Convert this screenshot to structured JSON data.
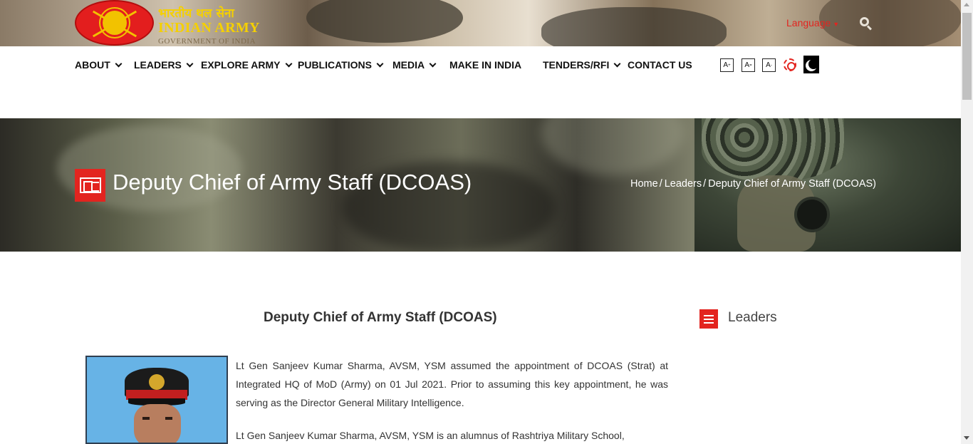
{
  "header": {
    "logo_hindi": "भारतीय थल सेना",
    "logo_english": "INDIAN ARMY",
    "logo_subtitle": "GOVERNMENT OF INDIA",
    "language_label": "Language",
    "search_icon": "search-icon"
  },
  "nav": {
    "items": [
      {
        "label": "ABOUT",
        "dropdown": true
      },
      {
        "label": "LEADERS",
        "dropdown": true
      },
      {
        "label": "EXPLORE ARMY",
        "dropdown": true
      },
      {
        "label": "PUBLICATIONS",
        "dropdown": true
      },
      {
        "label": "MEDIA",
        "dropdown": true
      },
      {
        "label": "MAKE IN INDIA",
        "dropdown": false
      },
      {
        "label": "TENDERS/RFI",
        "dropdown": true
      },
      {
        "label": "CONTACT US",
        "dropdown": false
      }
    ],
    "tools": {
      "font_increase": "A",
      "font_increase_sup": "+",
      "font_normal": "A",
      "font_normal_sup": "=",
      "font_decrease": "A",
      "font_decrease_sup": "-",
      "contrast_icon": "sun-icon",
      "dark_mode_icon": "moon-icon"
    }
  },
  "hero": {
    "title": "Deputy Chief of Army Staff (DCOAS)",
    "breadcrumb": [
      "Home",
      "Leaders",
      "Deputy Chief of Army Staff (DCOAS)"
    ],
    "breadcrumb_separator": "/"
  },
  "content": {
    "heading": "Deputy Chief of Army Staff (DCOAS)",
    "paragraphs": [
      "Lt Gen Sanjeev Kumar Sharma, AVSM, YSM assumed the appointment of DCOAS (Strat) at Integrated HQ of MoD (Army) on  01 Jul 2021.  Prior to assuming this key appointment, he was serving as the Director General Military Intelligence.",
      "Lt Gen Sanjeev Kumar Sharma, AVSM, YSM is an alumnus of Rashtriya Military School,"
    ]
  },
  "sidebar": {
    "title": "Leaders"
  },
  "colors": {
    "accent": "#e3241f",
    "logo_gold": "#f5d000"
  }
}
